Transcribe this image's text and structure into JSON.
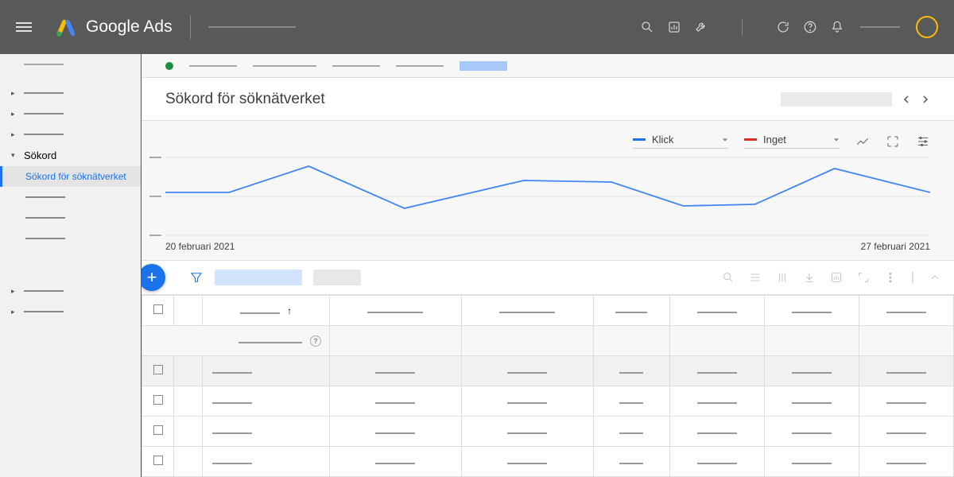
{
  "header": {
    "brand": "Google Ads"
  },
  "sidebar": {
    "sokord_label": "Sökord",
    "active_label": "Sökord för söknätverket"
  },
  "page": {
    "title": "Sökord för söknätverket"
  },
  "chart_data": {
    "type": "line",
    "metric1": {
      "label": "Klick",
      "color": "#1a73e8"
    },
    "metric2": {
      "label": "Inget",
      "color": "#d93025"
    },
    "x_start": "20 februari 2021",
    "x_end": "27 februari 2021",
    "series": [
      {
        "name": "Klick",
        "x": [
          0,
          1,
          2,
          3,
          4,
          5,
          6,
          7
        ],
        "y_norm": [
          0.55,
          0.55,
          0.88,
          0.35,
          0.7,
          0.68,
          0.38,
          0.4,
          0.85,
          0.55
        ]
      }
    ]
  }
}
